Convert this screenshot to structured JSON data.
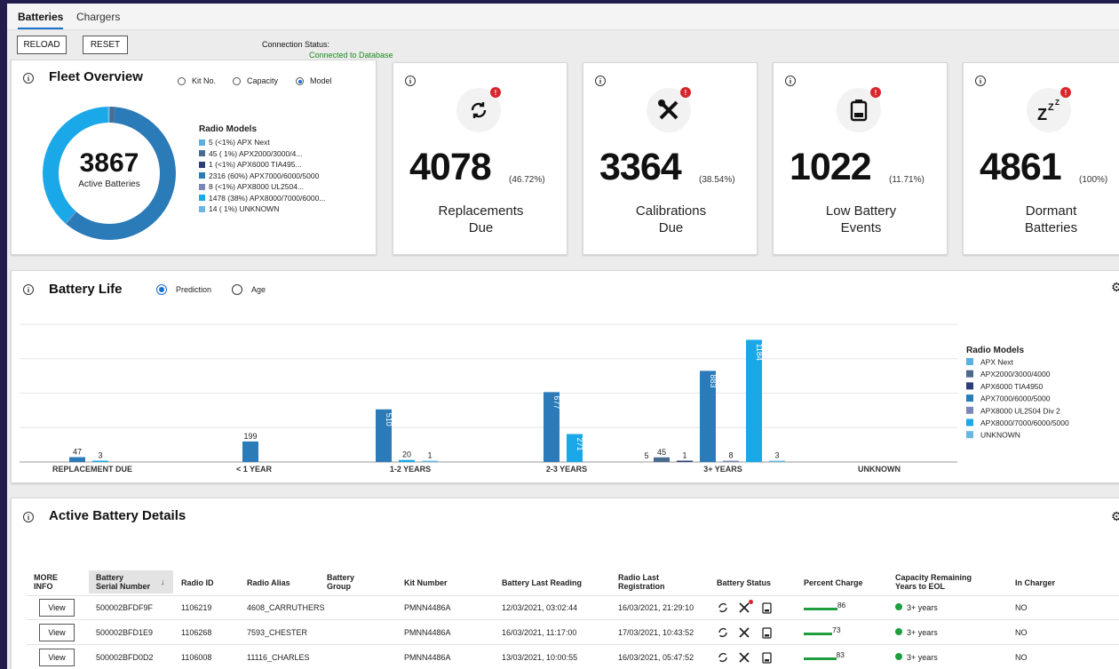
{
  "tabs": [
    "Batteries",
    "Chargers"
  ],
  "toolbar": {
    "reload_label": "RELOAD",
    "reset_label": "RESET"
  },
  "connection": {
    "label": "Connection Status:",
    "value": "Connected to Database"
  },
  "fleet": {
    "title": "Fleet Overview",
    "options": [
      "Kit No.",
      "Capacity",
      "Model"
    ],
    "selected": "Model",
    "total": "3867",
    "total_label": "Active Batteries",
    "legend_title": "Radio Models",
    "legend": [
      {
        "text": "5 (<1%) APX Next",
        "count": 5,
        "color": "#5ab0e0"
      },
      {
        "text": "45 ( 1%) APX2000/3000/4...",
        "count": 45,
        "color": "#4a6a8e"
      },
      {
        "text": "1 (<1%) APX6000 TIA495...",
        "count": 1,
        "color": "#2c3d7a"
      },
      {
        "text": "2316 (60%) APX7000/6000/5000",
        "count": 2316,
        "color": "#2a7bb8"
      },
      {
        "text": "8 (<1%) APX8000 UL2504...",
        "count": 8,
        "color": "#7a86b8"
      },
      {
        "text": "1478 (38%) APX8000/7000/6000...",
        "count": 1478,
        "color": "#1aa8e8"
      },
      {
        "text": "14 ( 1%) UNKNOWN",
        "count": 14,
        "color": "#6ab8e2"
      }
    ]
  },
  "kpis": [
    {
      "value": "4078",
      "pct": "(46.72%)",
      "label1": "Replacements",
      "label2": "Due",
      "icon": "refresh-icon"
    },
    {
      "value": "3364",
      "pct": "(38.54%)",
      "label1": "Calibrations",
      "label2": "Due",
      "icon": "tools-icon"
    },
    {
      "value": "1022",
      "pct": "(11.71%)",
      "label1": "Low Battery",
      "label2": "Events",
      "icon": "battery-icon"
    },
    {
      "value": "4861",
      "pct": "(100%)",
      "label1": "Dormant",
      "label2": "Batteries",
      "icon": "sleep-icon"
    }
  ],
  "battery_life": {
    "title": "Battery Life",
    "options": [
      "Prediction",
      "Age"
    ],
    "selected": "Prediction"
  },
  "chart_data": {
    "type": "bar",
    "categories": [
      "REPLACEMENT DUE",
      "< 1 YEAR",
      "1-2 YEARS",
      "2-3 YEARS",
      "3+ YEARS",
      "UNKNOWN"
    ],
    "legend_title": "Radio Models",
    "series": [
      {
        "name": "APX Next",
        "color": "#5ab0e0",
        "values": [
          null,
          null,
          null,
          null,
          null,
          null
        ]
      },
      {
        "name": "APX2000/3000/4000",
        "color": "#4a6a8e",
        "values": [
          null,
          null,
          null,
          null,
          45,
          null
        ]
      },
      {
        "name": "APX6000 TIA4950",
        "color": "#2c3d7a",
        "values": [
          null,
          null,
          null,
          null,
          1,
          null
        ]
      },
      {
        "name": "APX7000/6000/5000",
        "color": "#2a7bb8",
        "values": [
          47,
          199,
          510,
          677,
          883,
          null
        ]
      },
      {
        "name": "APX8000 UL2504 Div 2",
        "color": "#7a86b8",
        "values": [
          null,
          null,
          null,
          null,
          8,
          null
        ]
      },
      {
        "name": "APX8000/7000/6000/5000",
        "color": "#1aa8e8",
        "values": [
          3,
          null,
          20,
          271,
          1184,
          null
        ]
      },
      {
        "name": "UNKNOWN",
        "color": "#6ab8e2",
        "values": [
          null,
          null,
          1,
          null,
          3,
          null
        ]
      }
    ],
    "extra_labels": [
      {
        "category": "3+ YEARS",
        "value": 5
      }
    ],
    "ylim": [
      0,
      1300
    ],
    "grid": true,
    "legend_position": "right"
  },
  "details": {
    "title": "Active Battery Details",
    "columns": [
      "MORE INFO",
      "Battery Serial Number",
      "Radio ID",
      "Radio Alias",
      "Battery Group",
      "Kit Number",
      "Battery Last Reading",
      "Radio Last Registration",
      "Battery Status",
      "Percent Charge",
      "Capacity Remaining Years to EOL",
      "In Charger"
    ],
    "view_label": "View",
    "rows": [
      {
        "serial": "500002BFDF9F",
        "radio_id": "1106219",
        "alias": "4608_CARRUTHERS",
        "group": "",
        "kit": "PMNN4486A",
        "last_reading": "12/03/2021, 03:02:44",
        "last_reg": "16/03/2021, 21:29:10",
        "charge": 86,
        "eol": "3+ years",
        "charger": "NO",
        "alert": true
      },
      {
        "serial": "500002BFD1E9",
        "radio_id": "1106268",
        "alias": "7593_CHESTER",
        "group": "",
        "kit": "PMNN4486A",
        "last_reading": "16/03/2021, 11:17:00",
        "last_reg": "17/03/2021, 10:43:52",
        "charge": 73,
        "eol": "3+ years",
        "charger": "NO",
        "alert": false
      },
      {
        "serial": "500002BFD0D2",
        "radio_id": "1106008",
        "alias": "11116_CHARLES",
        "group": "",
        "kit": "PMNN4486A",
        "last_reading": "13/03/2021, 10:00:55",
        "last_reg": "16/03/2021, 05:47:52",
        "charge": 83,
        "eol": "3+ years",
        "charger": "NO",
        "alert": false
      }
    ]
  }
}
